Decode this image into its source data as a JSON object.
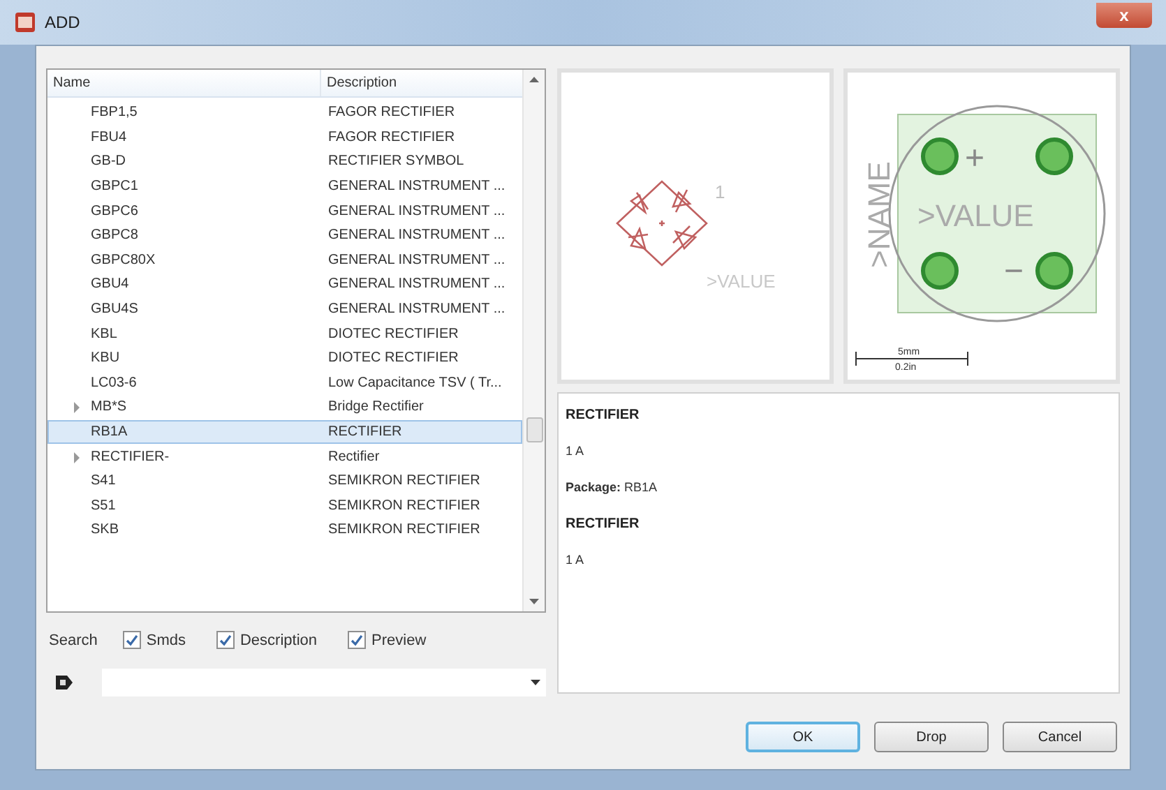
{
  "window": {
    "title": "ADD",
    "close": "x"
  },
  "parts_table": {
    "columns": [
      "Name",
      "Description"
    ],
    "rows": [
      {
        "name": "FBP1,5",
        "description": "FAGOR RECTIFIER",
        "expandable": false,
        "selected": false
      },
      {
        "name": "FBU4",
        "description": "FAGOR RECTIFIER",
        "expandable": false,
        "selected": false
      },
      {
        "name": "GB-D",
        "description": "RECTIFIER SYMBOL",
        "expandable": false,
        "selected": false
      },
      {
        "name": "GBPC1",
        "description": "GENERAL INSTRUMENT ...",
        "expandable": false,
        "selected": false
      },
      {
        "name": "GBPC6",
        "description": "GENERAL INSTRUMENT ...",
        "expandable": false,
        "selected": false
      },
      {
        "name": "GBPC8",
        "description": "GENERAL INSTRUMENT ...",
        "expandable": false,
        "selected": false
      },
      {
        "name": "GBPC80X",
        "description": "GENERAL INSTRUMENT ...",
        "expandable": false,
        "selected": false
      },
      {
        "name": "GBU4",
        "description": "GENERAL INSTRUMENT ...",
        "expandable": false,
        "selected": false
      },
      {
        "name": "GBU4S",
        "description": "GENERAL INSTRUMENT ...",
        "expandable": false,
        "selected": false
      },
      {
        "name": "KBL",
        "description": "DIOTEC RECTIFIER",
        "expandable": false,
        "selected": false
      },
      {
        "name": "KBU",
        "description": "DIOTEC RECTIFIER",
        "expandable": false,
        "selected": false
      },
      {
        "name": "LC03-6",
        "description": "Low Capacitance TSV ( Tr...",
        "expandable": false,
        "selected": false
      },
      {
        "name": "MB*S",
        "description": "Bridge Rectifier",
        "expandable": true,
        "selected": false
      },
      {
        "name": "RB1A",
        "description": "RECTIFIER",
        "expandable": false,
        "selected": true
      },
      {
        "name": "RECTIFIER-",
        "description": "Rectifier",
        "expandable": true,
        "selected": false
      },
      {
        "name": "S41",
        "description": "SEMIKRON RECTIFIER",
        "expandable": false,
        "selected": false
      },
      {
        "name": "S51",
        "description": "SEMIKRON RECTIFIER",
        "expandable": false,
        "selected": false
      },
      {
        "name": "SKB",
        "description": "SEMIKRON RECTIFIER",
        "expandable": false,
        "selected": false
      }
    ]
  },
  "search": {
    "label": "Search",
    "options": [
      {
        "label": "Smds",
        "checked": true
      },
      {
        "label": "Description",
        "checked": true
      },
      {
        "label": "Preview",
        "checked": true
      }
    ]
  },
  "symbol_preview": {
    "pin_label": "1",
    "value_label": ">VALUE"
  },
  "package_preview": {
    "name_label": ">NAME",
    "value_label": ">VALUE",
    "plus": "+",
    "minus": "−",
    "scale_mm": "5mm",
    "scale_in": "0.2in"
  },
  "description": [
    {
      "kind": "heading",
      "text": "RECTIFIER"
    },
    {
      "kind": "text",
      "text": "1 A"
    },
    {
      "kind": "text",
      "text": "**Package:** RB1A"
    },
    {
      "kind": "heading",
      "text": "RECTIFIER"
    },
    {
      "kind": "text",
      "text": "1 A"
    }
  ],
  "buttons": [
    {
      "label": "OK",
      "default": true
    },
    {
      "label": "Drop",
      "default": false
    },
    {
      "label": "Cancel",
      "default": false
    }
  ]
}
